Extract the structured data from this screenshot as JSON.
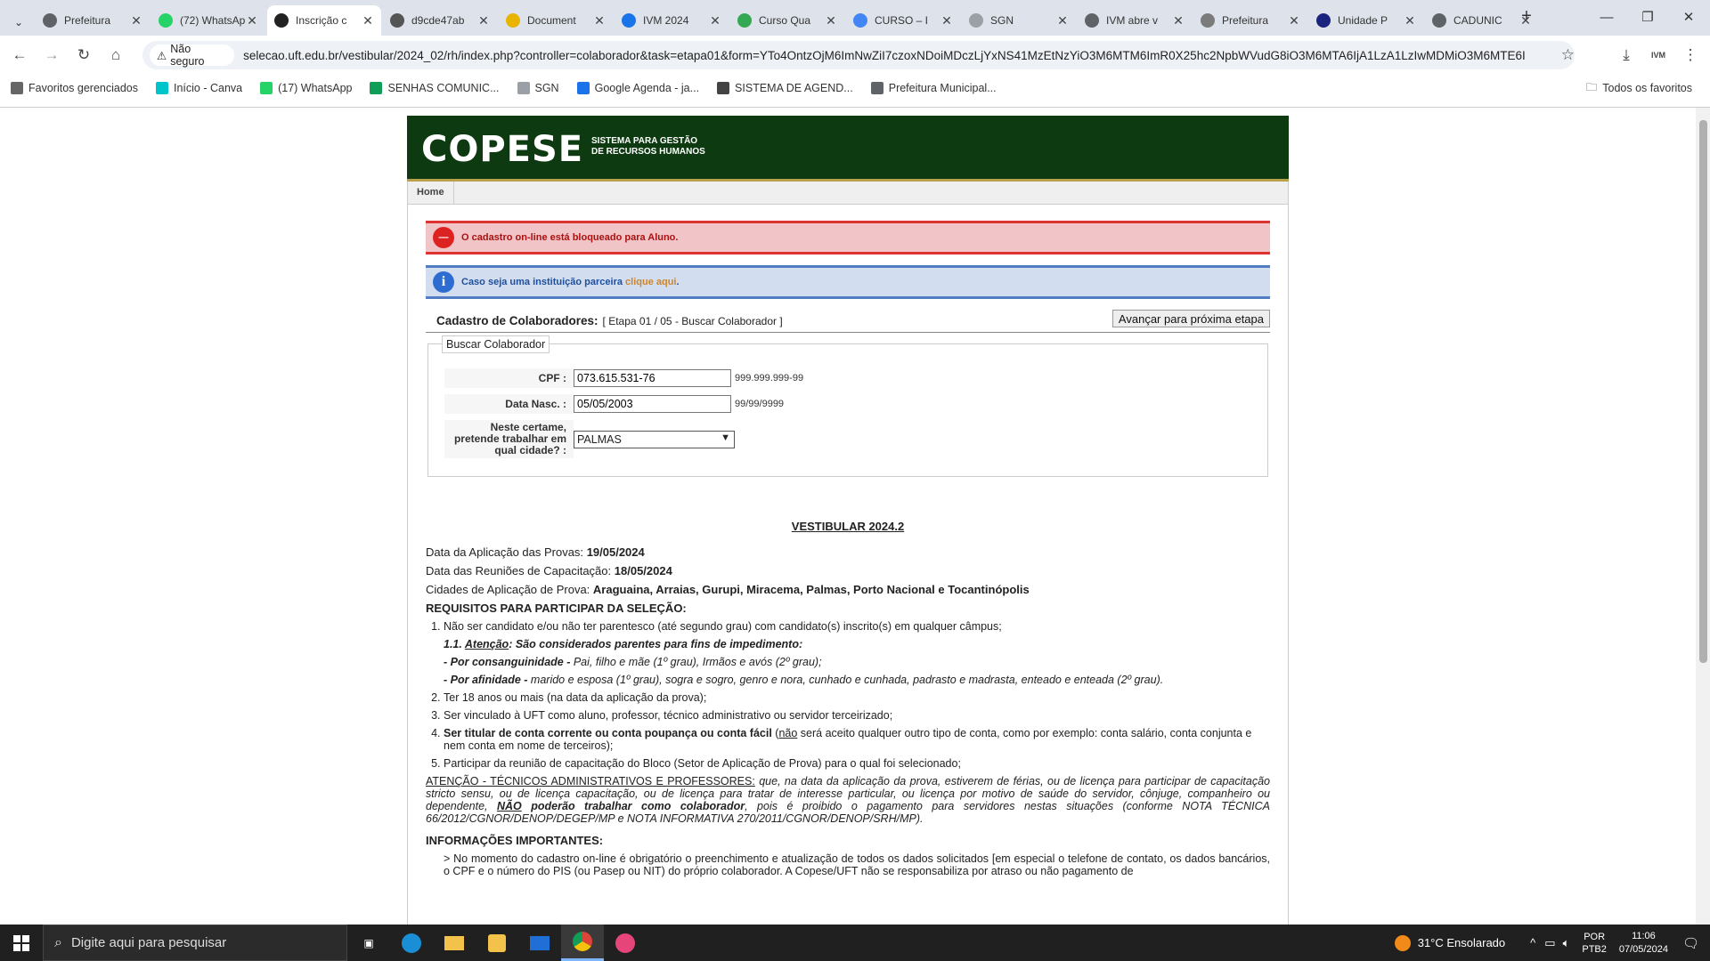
{
  "browser": {
    "tabs": [
      {
        "title": "Prefeitura",
        "color": "#5f6368"
      },
      {
        "title": "(72) WhatsApp",
        "color": "#25d366"
      },
      {
        "title": "Inscrição c",
        "color": "#222222"
      },
      {
        "title": "d9cde47ab",
        "color": "#555555"
      },
      {
        "title": "Document",
        "color": "#e8b400"
      },
      {
        "title": "IVM 2024",
        "color": "#1a73e8"
      },
      {
        "title": "Curso Qua",
        "color": "#34a853"
      },
      {
        "title": "CURSO – I",
        "color": "#4285f4"
      },
      {
        "title": "SGN",
        "color": "#9aa0a6"
      },
      {
        "title": "IVM abre v",
        "color": "#5f6368"
      },
      {
        "title": "Prefeitura",
        "color": "#7b7b7b"
      },
      {
        "title": "Unidade P",
        "color": "#1a237e"
      },
      {
        "title": "CADUNIC",
        "color": "#5f6368"
      }
    ],
    "new_tab": "+",
    "insecure_label": "Não seguro",
    "url": "selecao.uft.edu.br/vestibular/2024_02/rh/index.php?controller=colaborador&task=etapa01&form=YTo4OntzOjM6ImNwZiI7czoxNDoiMDczLjYxNS41MzEtNzYiO3M6MTM6ImR0X25hc2NpbWVudG8iO3M6MTA6IjA1LzA1LzIwMDMiO3M6MTE6I",
    "profile": "IVM",
    "bookmarks": [
      {
        "label": "Favoritos gerenciados",
        "color": "#666666"
      },
      {
        "label": "Início - Canva",
        "color": "#00c4cc"
      },
      {
        "label": "(17) WhatsApp",
        "color": "#25d366"
      },
      {
        "label": "SENHAS COMUNIC...",
        "color": "#0f9d58"
      },
      {
        "label": "SGN",
        "color": "#9aa0a6"
      },
      {
        "label": "Google Agenda - ja...",
        "color": "#1a73e8"
      },
      {
        "label": "SISTEMA DE AGEND...",
        "color": "#444444"
      },
      {
        "label": "Prefeitura Municipal...",
        "color": "#5f6368"
      }
    ],
    "all_bookmarks": "Todos os favoritos"
  },
  "site": {
    "logo": "COPESE",
    "subtitle_line1": "SISTEMA PARA GESTÃO",
    "subtitle_line2": "DE RECURSOS HUMANOS",
    "menu_home": "Home"
  },
  "alerts": {
    "blocked": "O cadastro on-line está bloqueado para Aluno.",
    "partner_prefix": "Caso seja uma instituição parceira ",
    "partner_link": "clique aqui",
    "partner_suffix": "."
  },
  "form": {
    "title": "Cadastro de Colaboradores:",
    "step": "[ Etapa 01 / 05 - Buscar Colaborador ]",
    "next_button": "Avançar para próxima etapa",
    "legend": "Buscar Colaborador",
    "cpf_label": "CPF :",
    "cpf_value": "073.615.531-76",
    "cpf_hint": "999.999.999-99",
    "birth_label": "Data Nasc. :",
    "birth_value": "05/05/2003",
    "birth_hint": "99/99/9999",
    "city_label": "Neste certame, pretende trabalhar em qual cidade? :",
    "city_value": "PALMAS"
  },
  "info": {
    "heading": "VESTIBULAR 2024.2",
    "exam_date_label": "Data da Aplicação das Provas:",
    "exam_date": "19/05/2024",
    "meeting_label": "Data das Reuniões de Capacitação:",
    "meeting_date": "18/05/2024",
    "cities_label": "Cidades de Aplicação de Prova:",
    "cities": "Araguaina, Arraias, Gurupi, Miracema, Palmas, Porto Nacional e Tocantinópolis",
    "req_heading": "REQUISITOS PARA PARTICIPAR DA SELEÇÃO:",
    "req1": "Não ser candidato e/ou não ter parentesco (até segundo grau) com candidato(s) inscrito(s) em qualquer câmpus;",
    "req1_1_num": "1.1.",
    "req1_1_word": "Atenção",
    "req1_1_rest": ": São considerados parentes para fins de impedimento:",
    "consang_label": "- Por consanguinidade -",
    "consang_text": " Pai, filho e mãe (1º grau), Irmãos e avós (2º grau);",
    "afin_label": "- Por afinidade -",
    "afin_text": " marido e esposa (1º grau), sogra e sogro, genro e nora, cunhado e cunhada, padrasto e madrasta, enteado e enteada (2º grau).",
    "req2": "Ter 18 anos ou mais (na data da aplicação da prova);",
    "req3": "Ser vinculado à UFT como aluno, professor, técnico administrativo ou servidor terceirizado;",
    "req4_bold": "Ser titular de conta corrente ou conta poupança ou conta fácil",
    "req4_open": " (",
    "req4_nao": "não",
    "req4_rest": " será aceito qualquer outro tipo de conta, como por exemplo: conta salário, conta conjunta e nem conta em nome de terceiros);",
    "req5": "Participar da reunião de capacitação do Bloco (Setor de Aplicação de Prova) para o qual foi selecionado;",
    "att_head": "ATENÇÃO - TÉCNICOS ADMINISTRATIVOS E PROFESSORES:",
    "att_text1": " que, na data da aplicação da prova, estiverem de férias, ou de licença para participar de capacitação stricto sensu, ou de licença capacitação, ou de licença para tratar de interesse particular, ou licença por motivo de saúde do servidor, cônjuge, companheiro ou dependente, ",
    "att_nao": "NÃO",
    "att_bold": " poderão trabalhar como colaborador",
    "att_text2": ", pois é proibido o pagamento para servidores nestas situações (conforme NOTA TÉCNICA 66/2012/CGNOR/DENOP/DEGEP/MP e NOTA INFORMATIVA 270/2011/CGNOR/DENOP/SRH/MP).",
    "imp_heading": "INFORMAÇÕES IMPORTANTES:",
    "imp1": "> No momento do cadastro on-line é obrigatório o preenchimento e atualização de todos os dados solicitados [em especial o telefone de contato, os dados bancários, o CPF e o número do PIS (ou Pasep ou NIT) do próprio colaborador. A Copese/UFT não se responsabiliza por atraso ou não pagamento de"
  },
  "taskbar": {
    "search_placeholder": "Digite aqui para pesquisar",
    "weather": "31°C  Ensolarado",
    "lang1": "POR",
    "lang2": "PTB2",
    "time": "11:06",
    "date": "07/05/2024"
  }
}
